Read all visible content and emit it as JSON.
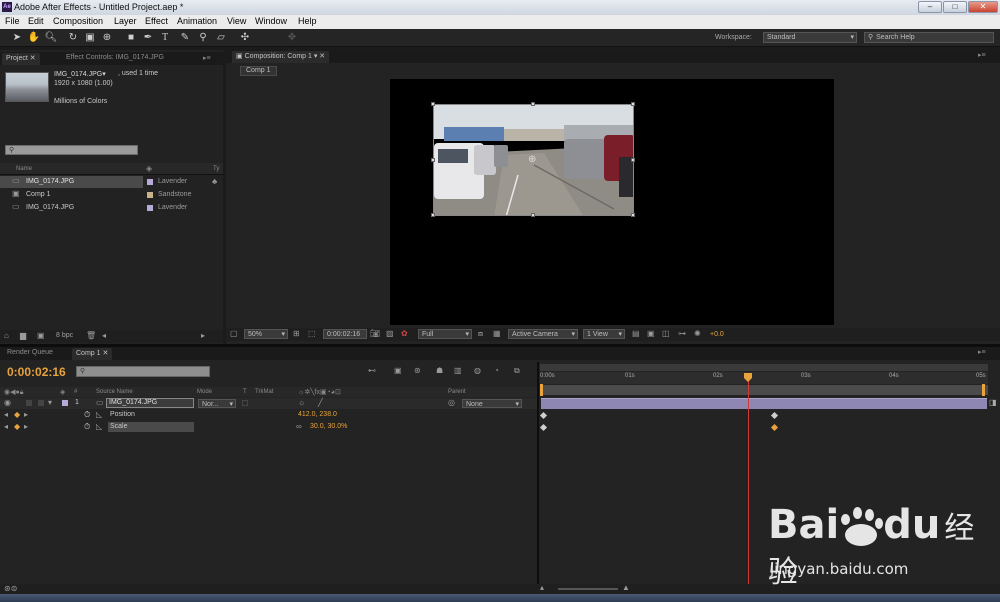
{
  "window": {
    "title": "Adobe After Effects - Untitled Project.aep *",
    "app_icon": "Ae"
  },
  "menu": [
    "File",
    "Edit",
    "Composition",
    "Layer",
    "Effect",
    "Animation",
    "View",
    "Window",
    "Help"
  ],
  "toolbar": {
    "workspace_label": "Workspace:",
    "workspace_value": "Standard",
    "search_placeholder": "Search Help"
  },
  "project_panel": {
    "tab_project": "Project",
    "tab_effect_controls": "Effect Controls: IMG_0174.JPG",
    "footage_name": "IMG_0174.JPG▾",
    "footage_used": ", used 1 time",
    "footage_dims": "1920 x 1080 (1.00)",
    "footage_colors": "Millions of Colors",
    "col_name": "Name",
    "col_type": "Ty",
    "items": [
      {
        "name": "IMG_0174.JPG",
        "label": "Lavender",
        "color": "#b7a9d8"
      },
      {
        "name": "Comp 1",
        "label": "Sandstone",
        "color": "#c9b38a"
      },
      {
        "name": "IMG_0174.JPG",
        "label": "Lavender",
        "color": "#b7a9d8"
      }
    ],
    "bpc": "8 bpc"
  },
  "composition_panel": {
    "tab": "Composition: Comp 1",
    "sub_tab": "Comp 1",
    "zoom": "50%",
    "timecode": "0:00:02:16",
    "resolution": "Full",
    "camera": "Active Camera",
    "views": "1 View",
    "exposure": "+0.0"
  },
  "timeline": {
    "tab_render_queue": "Render Queue",
    "tab_comp": "Comp 1",
    "current_time": "0:00:02:16",
    "col_num": "#",
    "col_source": "Source Name",
    "col_mode": "Mode",
    "col_t": "T",
    "col_trkmat": "TrkMat",
    "col_parent": "Parent",
    "ruler": [
      "0:00s",
      "01s",
      "02s",
      "03s",
      "04s",
      "05s"
    ],
    "layer": {
      "num": "1",
      "name": "IMG_0174.JPG",
      "mode": "Nor...",
      "parent": "None"
    },
    "properties": [
      {
        "name": "Position",
        "value": "412.0, 238.0"
      },
      {
        "name": "Scale",
        "value": "30.0, 30.0%"
      }
    ],
    "playhead_fraction": 0.465
  },
  "watermark": {
    "brand": "Bai",
    "brand2": "du",
    "cn": "经验",
    "url": "jingyan.baidu.com"
  },
  "colors": {
    "accent": "#e8a33c",
    "playhead": "#d23a3a",
    "layer_bar": "#8e86b3"
  }
}
